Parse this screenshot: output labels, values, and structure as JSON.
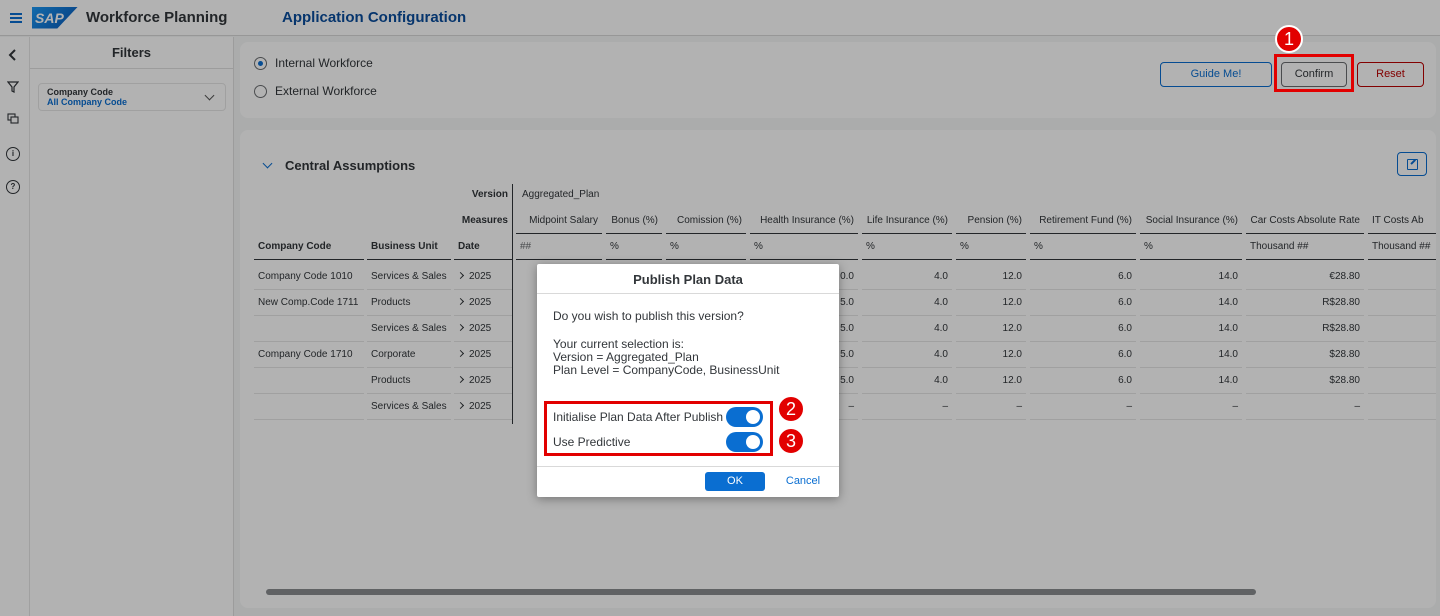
{
  "shell": {
    "logo_text": "SAP",
    "app_title": "Workforce Planning",
    "page_title": "Application Configuration"
  },
  "filters": {
    "title": "Filters",
    "company_code_label": "Company Code",
    "company_code_value": "All Company Code"
  },
  "workforce": {
    "options": [
      "Internal Workforce",
      "External Workforce"
    ],
    "selected": "Internal Workforce",
    "guide_label": "Guide Me!",
    "confirm_label": "Confirm",
    "reset_label": "Reset"
  },
  "assumptions": {
    "title": "Central Assumptions",
    "version_label": "Version",
    "version_value": "Aggregated_Plan",
    "measures_label": "Measures",
    "col_company_code": "Company Code",
    "col_business_unit": "Business Unit",
    "col_date": "Date",
    "measures": [
      {
        "name": "Midpoint Salary",
        "unit": "##"
      },
      {
        "name": "Bonus (%)",
        "unit": "%"
      },
      {
        "name": "Comission (%)",
        "unit": "%"
      },
      {
        "name": "Health Insurance (%)",
        "unit": "%"
      },
      {
        "name": "Life Insurance (%)",
        "unit": "%"
      },
      {
        "name": "Pension (%)",
        "unit": "%"
      },
      {
        "name": "Retirement Fund (%)",
        "unit": "%"
      },
      {
        "name": "Social Insurance (%)",
        "unit": "%"
      },
      {
        "name": "Car Costs Absolute Rate",
        "unit": "Thousand ##"
      },
      {
        "name": "IT Costs Ab",
        "unit": "Thousand ##"
      }
    ],
    "rows": [
      {
        "company": "Company Code 1010",
        "bu": "Services & Sales",
        "date": "2025",
        "health": "0.0",
        "life": "4.0",
        "pension": "12.0",
        "retirement": "6.0",
        "social": "14.0",
        "car": "€28.80"
      },
      {
        "company": "New Comp.Code 1711",
        "bu": "Products",
        "date": "2025",
        "health": "5.0",
        "life": "4.0",
        "pension": "12.0",
        "retirement": "6.0",
        "social": "14.0",
        "car": "R$28.80"
      },
      {
        "company": "",
        "bu": "Services & Sales",
        "date": "2025",
        "health": "5.0",
        "life": "4.0",
        "pension": "12.0",
        "retirement": "6.0",
        "social": "14.0",
        "car": "R$28.80"
      },
      {
        "company": "Company Code 1710",
        "bu": "Corporate",
        "date": "2025",
        "health": "5.0",
        "life": "4.0",
        "pension": "12.0",
        "retirement": "6.0",
        "social": "14.0",
        "car": "$28.80"
      },
      {
        "company": "",
        "bu": "Products",
        "date": "2025",
        "health": "5.0",
        "life": "4.0",
        "pension": "12.0",
        "retirement": "6.0",
        "social": "14.0",
        "car": "$28.80"
      },
      {
        "company": "",
        "bu": "Services & Sales",
        "date": "2025",
        "health": "–",
        "life": "–",
        "pension": "–",
        "retirement": "–",
        "social": "–",
        "car": "–"
      }
    ]
  },
  "dialog": {
    "title": "Publish Plan Data",
    "question": "Do you wish to publish this version?",
    "selection_heading": "Your current selection is:",
    "selection_version": "Version = Aggregated_Plan",
    "selection_level": "Plan Level = CompanyCode, BusinessUnit",
    "toggle_initialise_label": "Initialise Plan Data After Publish",
    "toggle_initialise_on": true,
    "toggle_predictive_label": "Use Predictive",
    "toggle_predictive_on": true,
    "ok_label": "OK",
    "cancel_label": "Cancel"
  },
  "annotations": {
    "badge_1": "1",
    "badge_2": "2",
    "badge_3": "3",
    "highlight_color": "#e20000"
  },
  "colors": {
    "accent": "#0a6ed1",
    "title_blue": "#0a4d9c",
    "reset_red": "#bb0000"
  }
}
